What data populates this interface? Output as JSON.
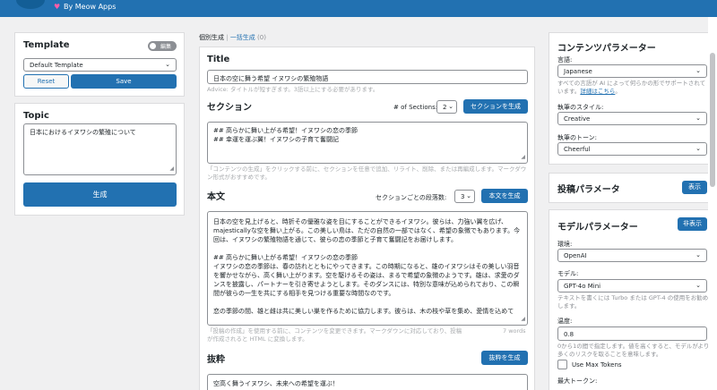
{
  "topbar": {
    "brand": "By Meow Apps"
  },
  "template": {
    "title": "Template",
    "toggle_label": "編集",
    "selected": "Default Template",
    "reset_label": "Reset",
    "save_label": "Save"
  },
  "topic": {
    "title": "Topic",
    "value": "日本におけるイヌワシの繁殖について",
    "generate_label": "生成"
  },
  "tabs": {
    "individual": "個別生成",
    "separator": " | ",
    "bulk": "一括生成",
    "bulk_count": "(0)"
  },
  "editor": {
    "title_label": "Title",
    "title_value": "日本の空に舞う希望 イヌワシの繁殖物語",
    "title_advice": "Advice: タイトルが短すぎます。3語以上にする必要があります。",
    "sections_label": "セクション",
    "num_sections_label": "# of Sections:",
    "num_sections_value": "2",
    "generate_sections_label": "セクションを生成",
    "sections_line1": "## 高らかに舞い上がる希望！イヌワシの恋の季節",
    "sections_line2": "## 幸運を運ぶ翼！イヌワシの子育て奮闘記",
    "sections_hint": "「コンテンツの生成」をクリックする前に、セクションを任意で追加、リライト、削除、または再編成します。マークダウン形式がおすすめです。",
    "content_label": "本文",
    "paragraphs_label": "セクションごとの段落数:",
    "paragraphs_value": "3",
    "generate_content_label": "本文を生成",
    "content_p1": "日本の空を見上げると、時折その優雅な姿を目にすることができるイヌワシ。彼らは、力強い翼を広げ、majesticallyな空を舞い上がる。この美しい鳥は、ただの自然の一部ではなく、希望の象徴でもあります。今回は、イヌワシの繁殖物語を通じて、彼らの恋の季節と子育て奮闘記をお届けします。",
    "content_h1": "## 高らかに舞い上がる希望！イヌワシの恋の季節",
    "content_p2": "イヌワシの恋の季節は、春の訪れとともにやってきます。この時期になると、雄のイヌワシはその美しい羽音を響かせながら、高く舞い上がります。空を駆けるその姿は、まるで希望の象徴のようです。雄は、求愛のダンスを披露し、パートナーを引き寄せようとします。そのダンスには、特別な意味が込められており、この瞬間が彼らの一生を共にする相手を見つける重要な時間なのです。",
    "content_p3": "恋の季節の間、雄と雌は共に美しい巣を作るために協力します。彼らは、木の枝や草を集め、愛情を込めて",
    "content_hint": "「投稿の作成」を使用する前に、コンテンツを変更できます。マークダウンに対応しており、投稿が作成されると HTML に変換します。",
    "word_count": "7 words",
    "excerpt_label": "抜粋",
    "generate_excerpt_label": "抜粋を生成",
    "excerpt_value": "空高く舞うイヌワシ、未来への希望を運ぶ！"
  },
  "content_params": {
    "title": "コンテンツパラメーター",
    "language_label": "言語:",
    "language_value": "Japanese",
    "language_hint": "すべての言語が AI によって何らかの形でサポートされています。",
    "language_link": "詳細はこちら",
    "language_hint_end": "。",
    "style_label": "執筆のスタイル:",
    "style_value": "Creative",
    "tone_label": "執筆のトーン:",
    "tone_value": "Cheerful"
  },
  "post_params": {
    "title": "投稿パラメータ",
    "show_label": "表示"
  },
  "model_params": {
    "title": "モデルパラメーター",
    "hide_label": "非表示",
    "env_label": "環境:",
    "env_value": "OpenAI",
    "model_label": "モデル:",
    "model_value": "GPT-4o Mini",
    "model_hint": "テキストを書くには Turbo または GPT-4 の使用をお勧めします。",
    "temp_label": "温度:",
    "temp_value": "0.8",
    "temp_hint": "0から1の間で指定します。値を高くすると、モデルがより多くのリスクを取ることを意味します。",
    "max_tokens_label": "Use Max Tokens",
    "max_tokens_field": "最大トークン:"
  },
  "icons": {
    "chevron": "chevron-down-icon",
    "grip": "resize-grip-icon",
    "heart": "heart-icon"
  },
  "colors": {
    "primary": "#2271b1",
    "topbar": "#2271b1",
    "heart": "#ff5ca8"
  }
}
